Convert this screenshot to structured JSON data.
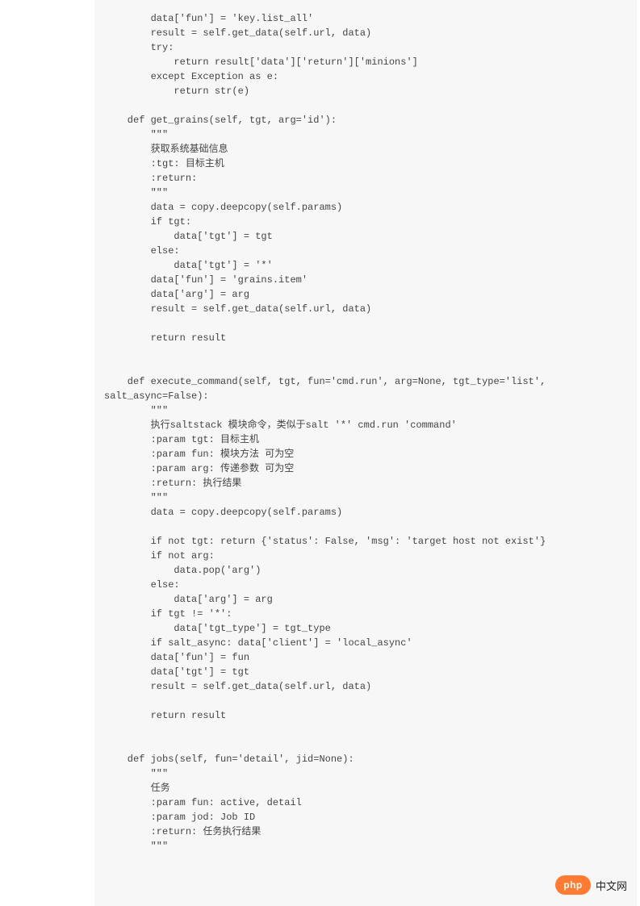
{
  "code": "        data['fun'] = 'key.list_all'\n        result = self.get_data(self.url, data)\n        try:\n            return result['data']['return']['minions']\n        except Exception as e:\n            return str(e)\n\n    def get_grains(self, tgt, arg='id'):\n        \"\"\"\n        获取系统基础信息\n        :tgt: 目标主机\n        :return:\n        \"\"\"\n        data = copy.deepcopy(self.params)\n        if tgt:\n            data['tgt'] = tgt\n        else:\n            data['tgt'] = '*'\n        data['fun'] = 'grains.item'\n        data['arg'] = arg\n        result = self.get_data(self.url, data)\n\n        return result\n\n\n    def execute_command(self, tgt, fun='cmd.run', arg=None, tgt_type='list',\nsalt_async=False):\n        \"\"\"\n        执行saltstack 模块命令，类似于salt '*' cmd.run 'command'\n        :param tgt: 目标主机\n        :param fun: 模块方法 可为空\n        :param arg: 传递参数 可为空\n        :return: 执行结果\n        \"\"\"\n        data = copy.deepcopy(self.params)\n\n        if not tgt: return {'status': False, 'msg': 'target host not exist'}\n        if not arg:\n            data.pop('arg')\n        else:\n            data['arg'] = arg\n        if tgt != '*':\n            data['tgt_type'] = tgt_type\n        if salt_async: data['client'] = 'local_async'\n        data['fun'] = fun\n        data['tgt'] = tgt\n        result = self.get_data(self.url, data)\n\n        return result\n\n\n    def jobs(self, fun='detail', jid=None):\n        \"\"\"\n        任务\n        :param fun: active, detail\n        :param jod: Job ID\n        :return: 任务执行结果\n        \"\"\"",
  "badge": {
    "pill": "php",
    "text": "中文网"
  }
}
